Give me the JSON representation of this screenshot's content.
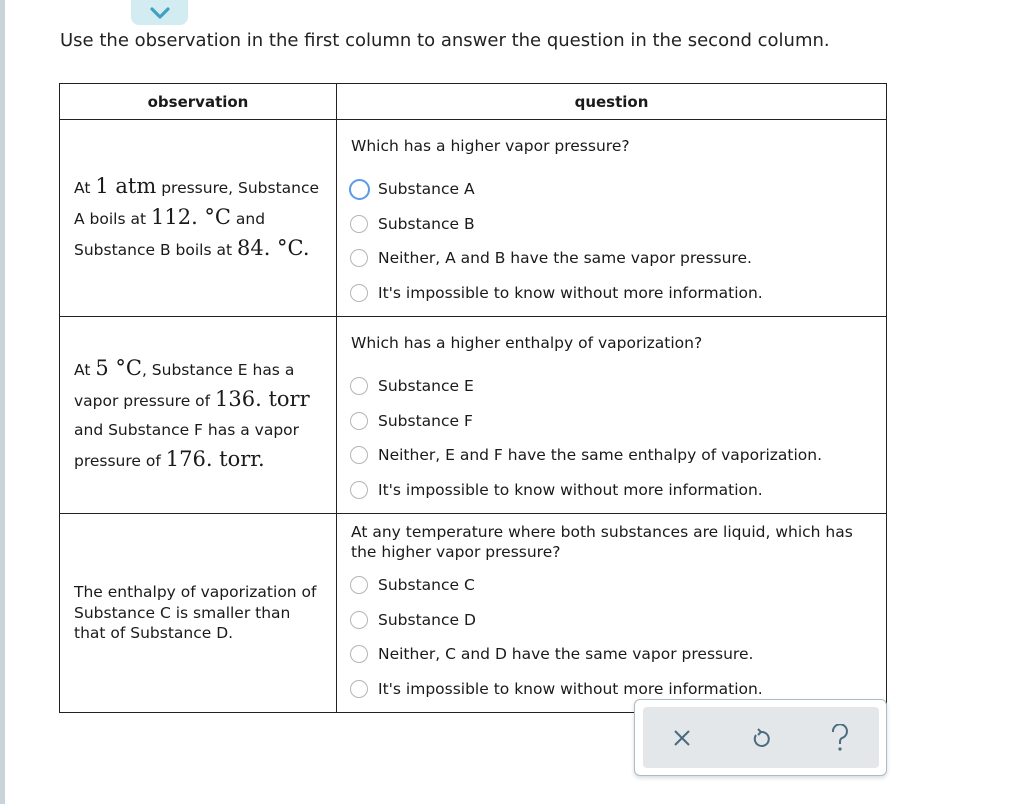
{
  "instruction": "Use the observation in the first column to answer the question in the second column.",
  "table": {
    "headers": {
      "observation": "observation",
      "question": "question"
    },
    "rows": [
      {
        "observation": [
          {
            "t": "At "
          },
          {
            "t": "1 atm",
            "big": true
          },
          {
            "t": " pressure, Substance A boils at "
          },
          {
            "t": "112. °C",
            "big": true
          },
          {
            "t": " and Substance B boils at "
          },
          {
            "t": "84. °C.",
            "big": true
          }
        ],
        "question": "Which has a higher vapor pressure?",
        "options": [
          "Substance A",
          "Substance B",
          "Neither, A and B have the same vapor pressure.",
          "It's impossible to know without more information."
        ],
        "focused_option": 0
      },
      {
        "observation": [
          {
            "t": "At "
          },
          {
            "t": "5 °C",
            "big": true
          },
          {
            "t": ", Substance E has a vapor pressure of "
          },
          {
            "t": "136. torr",
            "big": true
          },
          {
            "t": " and Substance F has a vapor pressure of "
          },
          {
            "t": "176. torr.",
            "big": true
          }
        ],
        "question": "Which has a higher enthalpy of vaporization?",
        "options": [
          "Substance E",
          "Substance F",
          "Neither, E and F have the same enthalpy of vaporization.",
          "It's impossible to know without more information."
        ],
        "focused_option": -1
      },
      {
        "observation": [
          {
            "t": "The enthalpy of vaporization of Substance C is smaller than that of Substance D."
          }
        ],
        "question": "At any temperature where both substances are liquid, which has the higher vapor pressure?",
        "options": [
          "Substance C",
          "Substance D",
          "Neither, C and D have the same vapor pressure.",
          "It's impossible to know without more information."
        ],
        "focused_option": -1
      }
    ]
  },
  "toolbar": {
    "buttons": [
      {
        "name": "clear-button",
        "icon": "close-icon",
        "glyph": "×"
      },
      {
        "name": "undo-button",
        "icon": "undo-icon",
        "glyph": "↺"
      },
      {
        "name": "help-button",
        "icon": "help-icon",
        "glyph": "?"
      }
    ]
  },
  "colors": {
    "focus_ring": "#5a9ae6",
    "collapse_bg": "#d3ecf2",
    "collapse_chevron": "#3fa3c0",
    "toolbar_icon": "#4a6b80"
  }
}
